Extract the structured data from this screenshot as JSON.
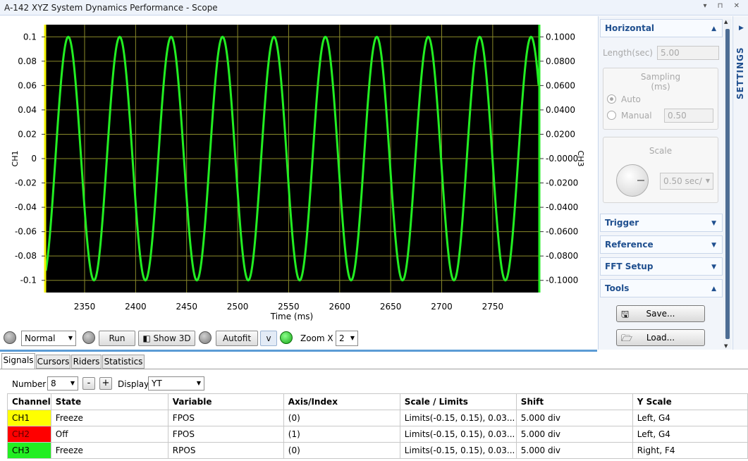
{
  "window": {
    "title": "A-142 XYZ System Dynamics Performance - Scope"
  },
  "scope": {
    "left_axis_label": "CH1",
    "right_axis_label": "CH3",
    "x_axis_label": "Time (ms)",
    "colors": {
      "plot_bg": "#000000",
      "grid": "#8a8a2a",
      "trace": "#22ee22",
      "left_axis_line": "#f0f000",
      "right_axis_line": "#22ee22"
    }
  },
  "chart_data": {
    "type": "line",
    "title": "",
    "xlabel": "Time (ms)",
    "ylabel": "CH1",
    "y2label": "CH3",
    "xlim": [
      2312,
      2795
    ],
    "ylim": [
      -0.11,
      0.11
    ],
    "y2lim": [
      -0.11,
      0.11
    ],
    "x_ticks": [
      "2350",
      "2400",
      "2450",
      "2500",
      "2550",
      "2600",
      "2650",
      "2700",
      "2750"
    ],
    "y_ticks": [
      "0.1",
      "0.08",
      "0.06",
      "0.04",
      "0.02",
      "0",
      "-0.02",
      "-0.04",
      "-0.06",
      "-0.08",
      "-0.1"
    ],
    "y2_ticks": [
      "0.1000",
      "0.0800",
      "0.0600",
      "0.0400",
      "0.0200",
      "-0.0000",
      "-0.0200",
      "-0.0400",
      "-0.0600",
      "-0.0800",
      "-0.1000"
    ],
    "grid": true,
    "series": [
      {
        "amplitude": 0.1,
        "period_ms": 50.4,
        "peak_x_ms": 2334,
        "color": "#22ee22"
      }
    ]
  },
  "toolbar": {
    "mode_value": "Normal",
    "run_label": "Run",
    "show3d_label": "Show 3D",
    "autofit_label": "Autofit",
    "v_label": "v",
    "zoom_label": "Zoom X",
    "zoom_value": "2"
  },
  "settings": {
    "vertical_tab": "SETTINGS",
    "horizontal": {
      "header": "Horizontal",
      "length_label": "Length(sec)",
      "length_value": "5.00",
      "sampling_title": "Sampling",
      "sampling_unit": "(ms)",
      "auto_label": "Auto",
      "manual_label": "Manual",
      "manual_value": "0.50",
      "scale_title": "Scale",
      "scale_value": "0.50 sec/"
    },
    "trigger_header": "Trigger",
    "reference_header": "Reference",
    "fft_header": "FFT Setup",
    "tools_header": "Tools",
    "save_label": "Save...",
    "load_label": "Load..."
  },
  "bottom": {
    "tabs": [
      "Signals",
      "Cursors",
      "Riders",
      "Statistics"
    ],
    "number_label": "Number",
    "number_value": "8",
    "minus_label": "-",
    "plus_label": "+",
    "display_label": "Display",
    "display_value": "YT",
    "columns": [
      "Channel",
      "State",
      "Variable",
      "Axis/Index",
      "Scale / Limits",
      "Shift",
      "Y Scale"
    ],
    "rows": [
      {
        "channel": "CH1",
        "color": "#ffff00",
        "state": "Freeze",
        "variable": "FPOS",
        "axis": "(0)",
        "scale": "Limits(-0.15, 0.15), 0.03...",
        "shift": "5.000 div",
        "yscale": "Left, G4"
      },
      {
        "channel": "CH2",
        "color": "#ff0000",
        "state": "Off",
        "variable": "FPOS",
        "axis": "(1)",
        "scale": "Limits(-0.15, 0.15), 0.03...",
        "shift": "5.000 div",
        "yscale": "Left, G4"
      },
      {
        "channel": "CH3",
        "color": "#22ee22",
        "state": "Freeze",
        "variable": "RPOS",
        "axis": "(0)",
        "scale": "Limits(-0.15, 0.15), 0.03...",
        "shift": "5.000 div",
        "yscale": "Right, F4"
      }
    ]
  }
}
